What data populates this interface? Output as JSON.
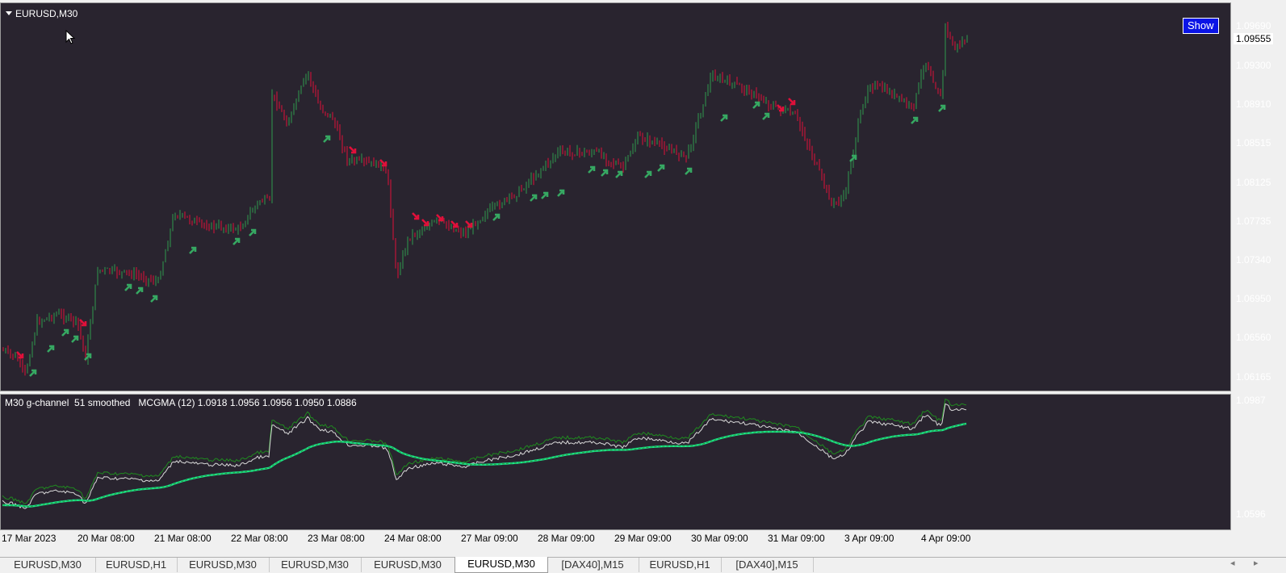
{
  "chart": {
    "symbol_title": "EURUSD,M30",
    "show_button": "Show",
    "current_price": "1.09555",
    "price_labels": [
      "1.09690",
      "1.09300",
      "1.08910",
      "1.08515",
      "1.08125",
      "1.07735",
      "1.07340",
      "1.06950",
      "1.06560",
      "1.06165"
    ],
    "indicator_title": "M30 g-channel  51 smoothed   MCGMA (12) 1.0918 1.0956 1.0956 1.0950 1.0886",
    "indicator_labels": [
      "1.0987",
      "1.0596"
    ],
    "time_labels": [
      "17 Mar 2023",
      "20 Mar 08:00",
      "21 Mar 08:00",
      "22 Mar 08:00",
      "23 Mar 08:00",
      "24 Mar 08:00",
      "27 Mar 09:00",
      "28 Mar 09:00",
      "29 Mar 09:00",
      "30 Mar 09:00",
      "31 Mar 09:00",
      "3 Apr 09:00",
      "4 Apr 09:00"
    ],
    "colors": {
      "background": "#29242f",
      "bull": "#2e9a4c",
      "bear": "#e0103a",
      "channel": "#19e68c",
      "green_line": "#1f8a1f"
    }
  },
  "tabs": {
    "items": [
      "EURUSD,M30",
      "EURUSD,H1",
      "EURUSD,M30",
      "EURUSD,M30",
      "EURUSD,M30",
      "EURUSD,M30",
      "[DAX40],M15",
      "EURUSD,H1",
      "[DAX40],M15"
    ],
    "active_index": 5,
    "nav_left": "◂",
    "nav_right": "▸"
  }
}
